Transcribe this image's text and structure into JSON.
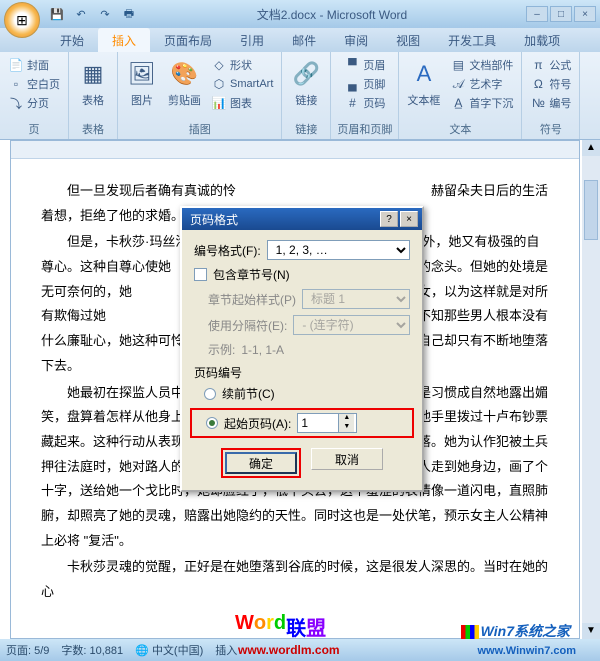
{
  "window": {
    "title": "文档2.docx - Microsoft Word",
    "qat": {
      "save": "💾",
      "undo": "↶",
      "redo": "↷",
      "print": "🖶"
    }
  },
  "tabs": {
    "home": "开始",
    "insert": "插入",
    "layout": "页面布局",
    "ref": "引用",
    "mail": "邮件",
    "review": "审阅",
    "view": "视图",
    "dev": "开发工具",
    "addins": "加载项"
  },
  "ribbon": {
    "pages": {
      "label": "页",
      "cover": "封面",
      "blank": "空白页",
      "break": "分页"
    },
    "tables": {
      "label": "表格",
      "table": "表格"
    },
    "illus": {
      "label": "插图",
      "pic": "图片",
      "clip": "剪贴画",
      "shape": "形状",
      "smart": "SmartArt",
      "chart": "图表"
    },
    "links": {
      "label": "链接",
      "link": "链接"
    },
    "hf": {
      "label": "页眉和页脚",
      "header": "页眉",
      "footer": "页脚",
      "pagenum": "页码"
    },
    "text": {
      "label": "文本",
      "textbox": "文本框",
      "parts": "文档部件",
      "art": "艺术字",
      "drop": "首字下沉"
    },
    "symbols": {
      "label": "符号",
      "eq": "公式",
      "sym": "符号",
      "num": "编号"
    }
  },
  "document": {
    "p1": "但一旦发现后者确有真诚的怜",
    "p1b": "赫留朵夫日后的生活着想，拒绝了他的求婚。",
    "p2a": "但是，卡秋莎·玛丝洛娃",
    "p2b": "良之外，她又有极强的自尊心。这种自尊心使她",
    "p2c": "抗和报复的念头。但她的处境是无可奈何的，她",
    "p2d": "害自己，当主妓女，以为这样就是对所有欺侮过她",
    "p2e": "赫留朵夫的报复，殊不知那些男人根本没有什么廉耻心，她这种可怜的行为并不能使他们感到丝毫内疚，而她自己却只有不断地堕落下去。",
    "p3": "她最初在探监人员中认出聂赫留朵夫时，并没有破口大骂，而是习惯成自然地露出媚笑，盘算着怎样从他身上捞几个钱。她龌龊典狱长不注意，一把从他手里拨过十卢布钞票藏起来。这种行动从表现上她不知羞耻，但她的精神并没有完全堕落。她为认作犯被土兵押往法庭时，她对路人的轻蔑目光满不在乎，可是一个卖煤的乡下人走到她身边，画了个十字，送给她一个戈比时，她却脸红了，低下头去，这个羞涩的表情像一道闪电，直照肺腑，却照亮了她的灵魂，赔露出她隐约的天性。同时这也是一处伏笔，预示女主人公精神上必将 \"复活\"。",
    "p4": "卡秋莎灵魂的觉醒，正好是在她堕落到谷底的时候，这是很发人深思的。当时在她的心"
  },
  "dialog": {
    "title": "页码格式",
    "format_label": "编号格式(F):",
    "format_value": "1, 2, 3, …",
    "include_chapter": "包含章节号(N)",
    "chapter_style_label": "章节起始样式(P)",
    "chapter_style_value": "标题 1",
    "separator_label": "使用分隔符(E):",
    "separator_value": "-  (连字符)",
    "example_label": "示例:",
    "example_value": "1-1, 1-A",
    "section_label": "页码编号",
    "continue": "续前节(C)",
    "start_at": "起始页码(A):",
    "start_value": "1",
    "ok": "确定",
    "cancel": "取消"
  },
  "status": {
    "page": "页面: 5/9",
    "words": "字数: 10,881",
    "ime": "中文(中国)",
    "lang": "插入"
  },
  "watermark": {
    "wm1_text": "Word联盟",
    "wm1_url": "www.wordlm.com",
    "wm2_text": "7系统之家",
    "wm2_url": "www.Winwin7.com"
  }
}
